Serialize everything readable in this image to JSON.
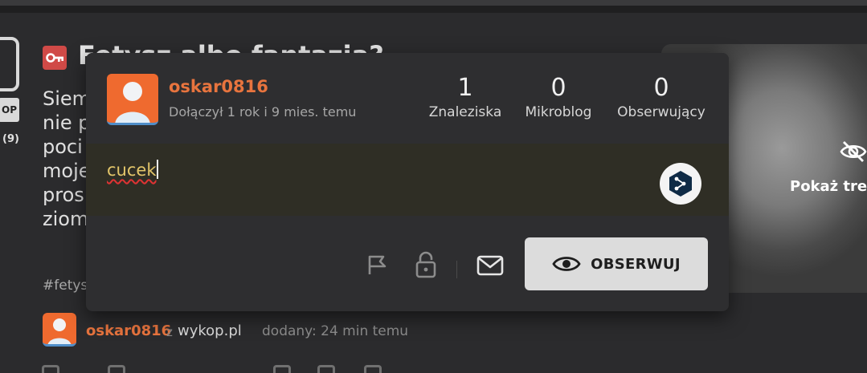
{
  "article": {
    "title": "Fetysz albo fantazja?",
    "op_badge": "OP",
    "count_label": "(9)",
    "text_lines": [
      "Siem",
      "nie p",
      "poci",
      "moje",
      "pros",
      "ziom"
    ],
    "tags": "#fetys",
    "show_content_label": "Pokaż treś"
  },
  "author": {
    "name": "oskar0816",
    "z": "z",
    "site": "wykop.pl",
    "added": "dodany: 24 min temu"
  },
  "popup": {
    "username": "oskar0816",
    "joined": "Dołączył 1 rok i 9 mies. temu",
    "stats": [
      {
        "value": "1",
        "label": "Znaleziska"
      },
      {
        "value": "0",
        "label": "Mikroblog"
      },
      {
        "value": "0",
        "label": "Obserwujący"
      }
    ],
    "note_text": "cucek",
    "follow_label": "OBSERWUJ",
    "icons": {
      "report": "flag-icon",
      "block": "lock-icon",
      "message": "mail-icon",
      "follow": "eye-icon",
      "translate": "deepl-icon"
    }
  },
  "colors": {
    "accent_orange": "#e8743e",
    "avatar_orange": "#ef6a2f",
    "note_text": "#e3c66a",
    "button_bg": "#dcdcdc"
  }
}
